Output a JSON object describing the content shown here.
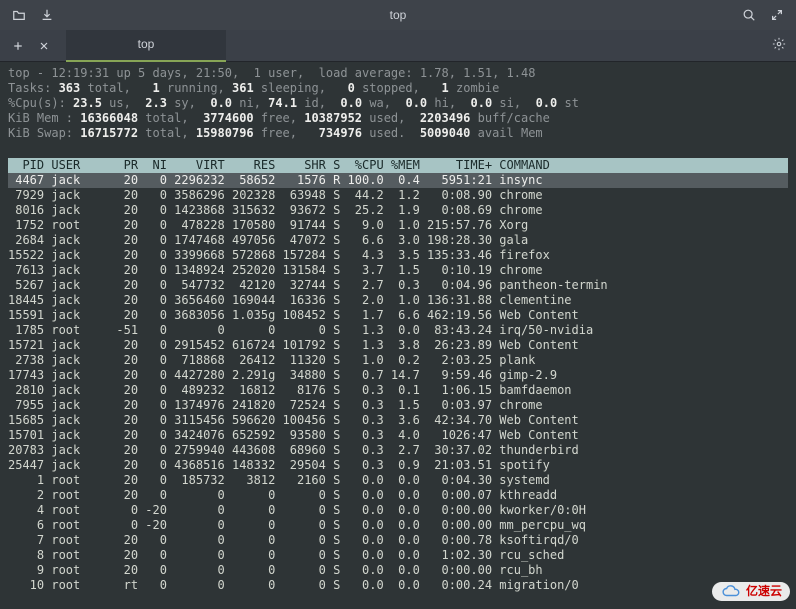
{
  "window": {
    "title": "top",
    "tab_label": "top"
  },
  "summary": {
    "uptime_line": {
      "pre": "top - ",
      "time": "12:19:31",
      "mid1": " up 5 days, 21:50,  1 user,  load average: ",
      "loads": "1.78, 1.51, 1.48"
    },
    "tasks": {
      "pre": "Tasks: ",
      "total": "363",
      "l1": " total,   ",
      "run": "1",
      "l2": " running, ",
      "sleep": "361",
      "l3": " sleeping,   ",
      "stop": "0",
      "l4": " stopped,   ",
      "zomb": "1",
      "l5": " zombie"
    },
    "cpu": {
      "pre": "%Cpu(s): ",
      "us": "23.5",
      "l1": " us,  ",
      "sy": "2.3",
      "l2": " sy,  ",
      "ni": "0.0",
      "l3": " ni, ",
      "id": "74.1",
      "l4": " id,  ",
      "wa": "0.0",
      "l5": " wa,  ",
      "hi": "0.0",
      "l6": " hi,  ",
      "si": "0.0",
      "l7": " si,  ",
      "st": "0.0",
      "l8": " st"
    },
    "mem": {
      "pre": "KiB Mem : ",
      "total": "16366048",
      "l1": " total,  ",
      "free": "3774600",
      "l2": " free, ",
      "used": "10387952",
      "l3": " used,  ",
      "buff": "2203496",
      "l4": " buff/cache"
    },
    "swap": {
      "pre": "KiB Swap: ",
      "total": "16715772",
      "l1": " total, ",
      "free": "15980796",
      "l2": " free,   ",
      "used": "734976",
      "l3": " used.  ",
      "avail": "5009040",
      "l4": " avail Mem"
    }
  },
  "columns": "  PID USER      PR  NI    VIRT    RES    SHR S  %CPU %MEM     TIME+ COMMAND           ",
  "rows": [
    {
      "pid": "4467",
      "user": "jack",
      "pr": "20",
      "ni": "0",
      "virt": "2296232",
      "res": "58652",
      "shr": "1576",
      "s": "R",
      "cpu": "100.0",
      "mem": "0.4",
      "time": "5951:21",
      "cmd": "insync"
    },
    {
      "pid": "7929",
      "user": "jack",
      "pr": "20",
      "ni": "0",
      "virt": "3586296",
      "res": "202328",
      "shr": "63948",
      "s": "S",
      "cpu": "44.2",
      "mem": "1.2",
      "time": "0:08.90",
      "cmd": "chrome"
    },
    {
      "pid": "8016",
      "user": "jack",
      "pr": "20",
      "ni": "0",
      "virt": "1423868",
      "res": "315632",
      "shr": "93672",
      "s": "S",
      "cpu": "25.2",
      "mem": "1.9",
      "time": "0:08.69",
      "cmd": "chrome"
    },
    {
      "pid": "1752",
      "user": "root",
      "pr": "20",
      "ni": "0",
      "virt": "478228",
      "res": "170580",
      "shr": "91744",
      "s": "S",
      "cpu": "9.0",
      "mem": "1.0",
      "time": "215:57.76",
      "cmd": "Xorg"
    },
    {
      "pid": "2684",
      "user": "jack",
      "pr": "20",
      "ni": "0",
      "virt": "1747468",
      "res": "497056",
      "shr": "47072",
      "s": "S",
      "cpu": "6.6",
      "mem": "3.0",
      "time": "198:28.30",
      "cmd": "gala"
    },
    {
      "pid": "15522",
      "user": "jack",
      "pr": "20",
      "ni": "0",
      "virt": "3399668",
      "res": "572868",
      "shr": "157284",
      "s": "S",
      "cpu": "4.3",
      "mem": "3.5",
      "time": "135:33.46",
      "cmd": "firefox"
    },
    {
      "pid": "7613",
      "user": "jack",
      "pr": "20",
      "ni": "0",
      "virt": "1348924",
      "res": "252020",
      "shr": "131584",
      "s": "S",
      "cpu": "3.7",
      "mem": "1.5",
      "time": "0:10.19",
      "cmd": "chrome"
    },
    {
      "pid": "5267",
      "user": "jack",
      "pr": "20",
      "ni": "0",
      "virt": "547732",
      "res": "42120",
      "shr": "32744",
      "s": "S",
      "cpu": "2.7",
      "mem": "0.3",
      "time": "0:04.96",
      "cmd": "pantheon-termin"
    },
    {
      "pid": "18445",
      "user": "jack",
      "pr": "20",
      "ni": "0",
      "virt": "3656460",
      "res": "169044",
      "shr": "16336",
      "s": "S",
      "cpu": "2.0",
      "mem": "1.0",
      "time": "136:31.88",
      "cmd": "clementine"
    },
    {
      "pid": "15591",
      "user": "jack",
      "pr": "20",
      "ni": "0",
      "virt": "3683056",
      "res": "1.035g",
      "shr": "108452",
      "s": "S",
      "cpu": "1.7",
      "mem": "6.6",
      "time": "462:19.56",
      "cmd": "Web Content"
    },
    {
      "pid": "1785",
      "user": "root",
      "pr": "-51",
      "ni": "0",
      "virt": "0",
      "res": "0",
      "shr": "0",
      "s": "S",
      "cpu": "1.3",
      "mem": "0.0",
      "time": "83:43.24",
      "cmd": "irq/50-nvidia"
    },
    {
      "pid": "15721",
      "user": "jack",
      "pr": "20",
      "ni": "0",
      "virt": "2915452",
      "res": "616724",
      "shr": "101792",
      "s": "S",
      "cpu": "1.3",
      "mem": "3.8",
      "time": "26:23.89",
      "cmd": "Web Content"
    },
    {
      "pid": "2738",
      "user": "jack",
      "pr": "20",
      "ni": "0",
      "virt": "718868",
      "res": "26412",
      "shr": "11320",
      "s": "S",
      "cpu": "1.0",
      "mem": "0.2",
      "time": "2:03.25",
      "cmd": "plank"
    },
    {
      "pid": "17743",
      "user": "jack",
      "pr": "20",
      "ni": "0",
      "virt": "4427280",
      "res": "2.291g",
      "shr": "34880",
      "s": "S",
      "cpu": "0.7",
      "mem": "14.7",
      "time": "9:59.46",
      "cmd": "gimp-2.9"
    },
    {
      "pid": "2810",
      "user": "jack",
      "pr": "20",
      "ni": "0",
      "virt": "489232",
      "res": "16812",
      "shr": "8176",
      "s": "S",
      "cpu": "0.3",
      "mem": "0.1",
      "time": "1:06.15",
      "cmd": "bamfdaemon"
    },
    {
      "pid": "7955",
      "user": "jack",
      "pr": "20",
      "ni": "0",
      "virt": "1374976",
      "res": "241820",
      "shr": "72524",
      "s": "S",
      "cpu": "0.3",
      "mem": "1.5",
      "time": "0:03.97",
      "cmd": "chrome"
    },
    {
      "pid": "15685",
      "user": "jack",
      "pr": "20",
      "ni": "0",
      "virt": "3115456",
      "res": "596620",
      "shr": "100456",
      "s": "S",
      "cpu": "0.3",
      "mem": "3.6",
      "time": "42:34.70",
      "cmd": "Web Content"
    },
    {
      "pid": "15701",
      "user": "jack",
      "pr": "20",
      "ni": "0",
      "virt": "3424076",
      "res": "652592",
      "shr": "93580",
      "s": "S",
      "cpu": "0.3",
      "mem": "4.0",
      "time": "1026:47",
      "cmd": "Web Content"
    },
    {
      "pid": "20783",
      "user": "jack",
      "pr": "20",
      "ni": "0",
      "virt": "2759940",
      "res": "443608",
      "shr": "68960",
      "s": "S",
      "cpu": "0.3",
      "mem": "2.7",
      "time": "30:37.02",
      "cmd": "thunderbird"
    },
    {
      "pid": "25447",
      "user": "jack",
      "pr": "20",
      "ni": "0",
      "virt": "4368516",
      "res": "148332",
      "shr": "29504",
      "s": "S",
      "cpu": "0.3",
      "mem": "0.9",
      "time": "21:03.51",
      "cmd": "spotify"
    },
    {
      "pid": "1",
      "user": "root",
      "pr": "20",
      "ni": "0",
      "virt": "185732",
      "res": "3812",
      "shr": "2160",
      "s": "S",
      "cpu": "0.0",
      "mem": "0.0",
      "time": "0:04.30",
      "cmd": "systemd"
    },
    {
      "pid": "2",
      "user": "root",
      "pr": "20",
      "ni": "0",
      "virt": "0",
      "res": "0",
      "shr": "0",
      "s": "S",
      "cpu": "0.0",
      "mem": "0.0",
      "time": "0:00.07",
      "cmd": "kthreadd"
    },
    {
      "pid": "4",
      "user": "root",
      "pr": "0",
      "ni": "-20",
      "virt": "0",
      "res": "0",
      "shr": "0",
      "s": "S",
      "cpu": "0.0",
      "mem": "0.0",
      "time": "0:00.00",
      "cmd": "kworker/0:0H"
    },
    {
      "pid": "6",
      "user": "root",
      "pr": "0",
      "ni": "-20",
      "virt": "0",
      "res": "0",
      "shr": "0",
      "s": "S",
      "cpu": "0.0",
      "mem": "0.0",
      "time": "0:00.00",
      "cmd": "mm_percpu_wq"
    },
    {
      "pid": "7",
      "user": "root",
      "pr": "20",
      "ni": "0",
      "virt": "0",
      "res": "0",
      "shr": "0",
      "s": "S",
      "cpu": "0.0",
      "mem": "0.0",
      "time": "0:00.78",
      "cmd": "ksoftirqd/0"
    },
    {
      "pid": "8",
      "user": "root",
      "pr": "20",
      "ni": "0",
      "virt": "0",
      "res": "0",
      "shr": "0",
      "s": "S",
      "cpu": "0.0",
      "mem": "0.0",
      "time": "1:02.30",
      "cmd": "rcu_sched"
    },
    {
      "pid": "9",
      "user": "root",
      "pr": "20",
      "ni": "0",
      "virt": "0",
      "res": "0",
      "shr": "0",
      "s": "S",
      "cpu": "0.0",
      "mem": "0.0",
      "time": "0:00.00",
      "cmd": "rcu_bh"
    },
    {
      "pid": "10",
      "user": "root",
      "pr": "rt",
      "ni": "0",
      "virt": "0",
      "res": "0",
      "shr": "0",
      "s": "S",
      "cpu": "0.0",
      "mem": "0.0",
      "time": "0:00.24",
      "cmd": "migration/0"
    }
  ],
  "watermark": "亿速云"
}
